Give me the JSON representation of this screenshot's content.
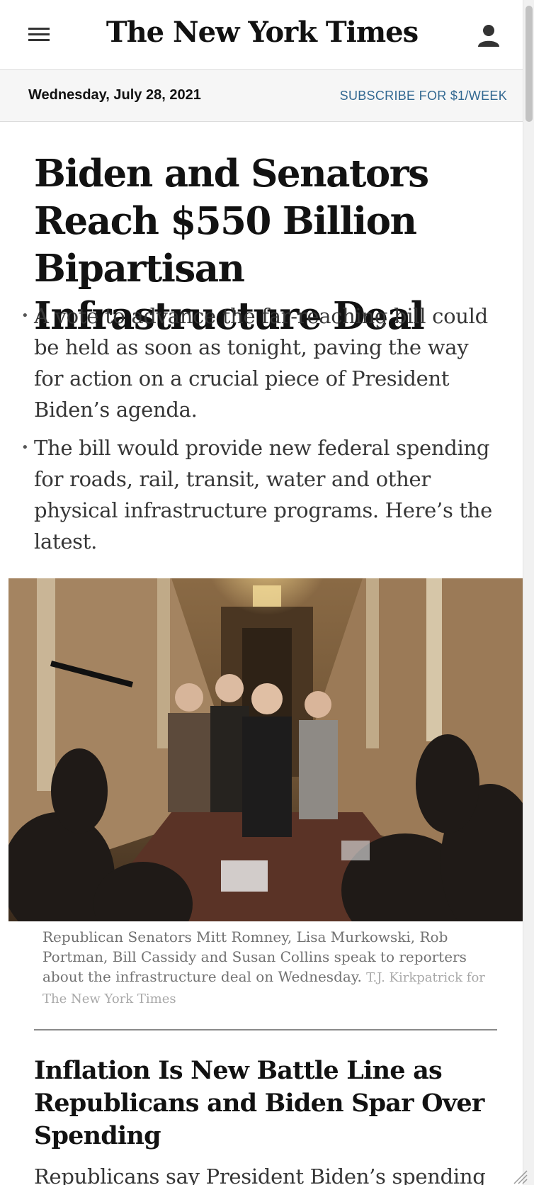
{
  "header": {
    "logo_text": "The New York Times",
    "menu_icon": "hamburger-menu-icon",
    "account_icon": "user-account-icon"
  },
  "date_bar": {
    "date": "Wednesday, July 28, 2021",
    "subscribe_label": "SUBSCRIBE FOR $1/WEEK"
  },
  "lead_story": {
    "headline": "Biden and Senators Reach $550 Billion Bipartisan Infrastructure Deal",
    "summary_points": [
      "A vote to advance the far-reaching bill could be held as soon as tonight, paving the way for action on a crucial piece of President Biden’s agenda.",
      "The bill would provide new federal spending for roads, rail, transit, water and other physical infrastructure programs. Here’s the latest."
    ],
    "caption": "Republican Senators Mitt Romney, Lisa Murkowski, Rob Portman, Bill Cassidy and Susan Collins speak to reporters about the infrastructure deal on Wednesday.",
    "credit": "T.J. Kirkpatrick for The New York Times"
  },
  "second_story": {
    "headline": "Inflation Is New Battle Line as Republicans and Biden Spar Over Spending",
    "summary": "Republicans say President Biden’s spending"
  },
  "colors": {
    "link_blue": "#326891",
    "headline_text": "#121212",
    "summary_text": "#363636",
    "caption_text": "#727272",
    "credit_text": "#a8a8a8",
    "date_bar_bg": "#f6f6f6"
  }
}
